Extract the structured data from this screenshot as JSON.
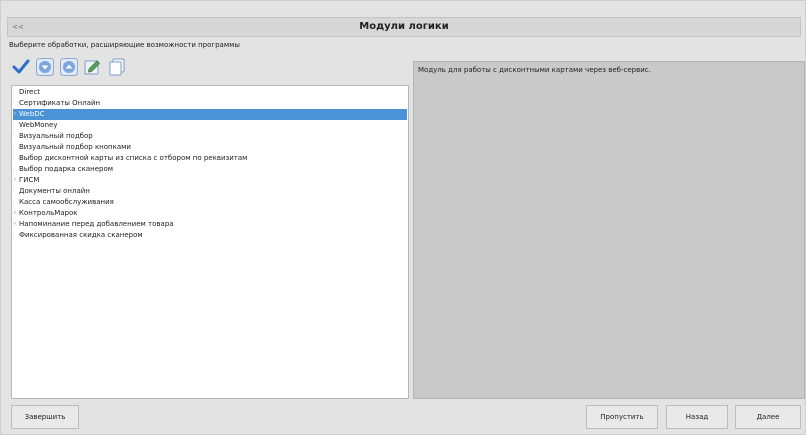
{
  "window": {
    "title": "Модули логики",
    "system_button": "<<"
  },
  "instruction": "Выберите обработки, расширяющие возможности программы",
  "toolbar": {
    "icons": [
      "check-icon",
      "arrow-down-icon",
      "arrow-up-icon",
      "edit-icon",
      "copy-icon"
    ]
  },
  "list": {
    "items": [
      {
        "label": "Direct",
        "checked": false
      },
      {
        "label": "Сертификаты Онлайн",
        "checked": false
      },
      {
        "label": "WebDC",
        "checked": true,
        "selected": true
      },
      {
        "label": "WebMoney",
        "checked": false
      },
      {
        "label": "Визуальный подбор",
        "checked": false
      },
      {
        "label": "Визуальный подбор кнопками",
        "checked": false
      },
      {
        "label": "Выбор дисконтной карты из списка с отбором по реквизитам",
        "checked": false
      },
      {
        "label": "Выбор подарка сканером",
        "checked": false
      },
      {
        "label": "ГИСМ",
        "checked": true
      },
      {
        "label": "Документы онлайн",
        "checked": false
      },
      {
        "label": "Касса самообслуживания",
        "checked": false
      },
      {
        "label": "КонтрольМарок",
        "checked": true
      },
      {
        "label": "Напоминание перед добавлением товара",
        "checked": true
      },
      {
        "label": "Фиксированная скидка сканером",
        "checked": false
      }
    ]
  },
  "description": "Модуль для работы с дисконтными картами через веб-сервис.",
  "buttons": {
    "finish": "Завершить",
    "skip": "Пропустить",
    "back": "Назад",
    "next": "Далее"
  }
}
